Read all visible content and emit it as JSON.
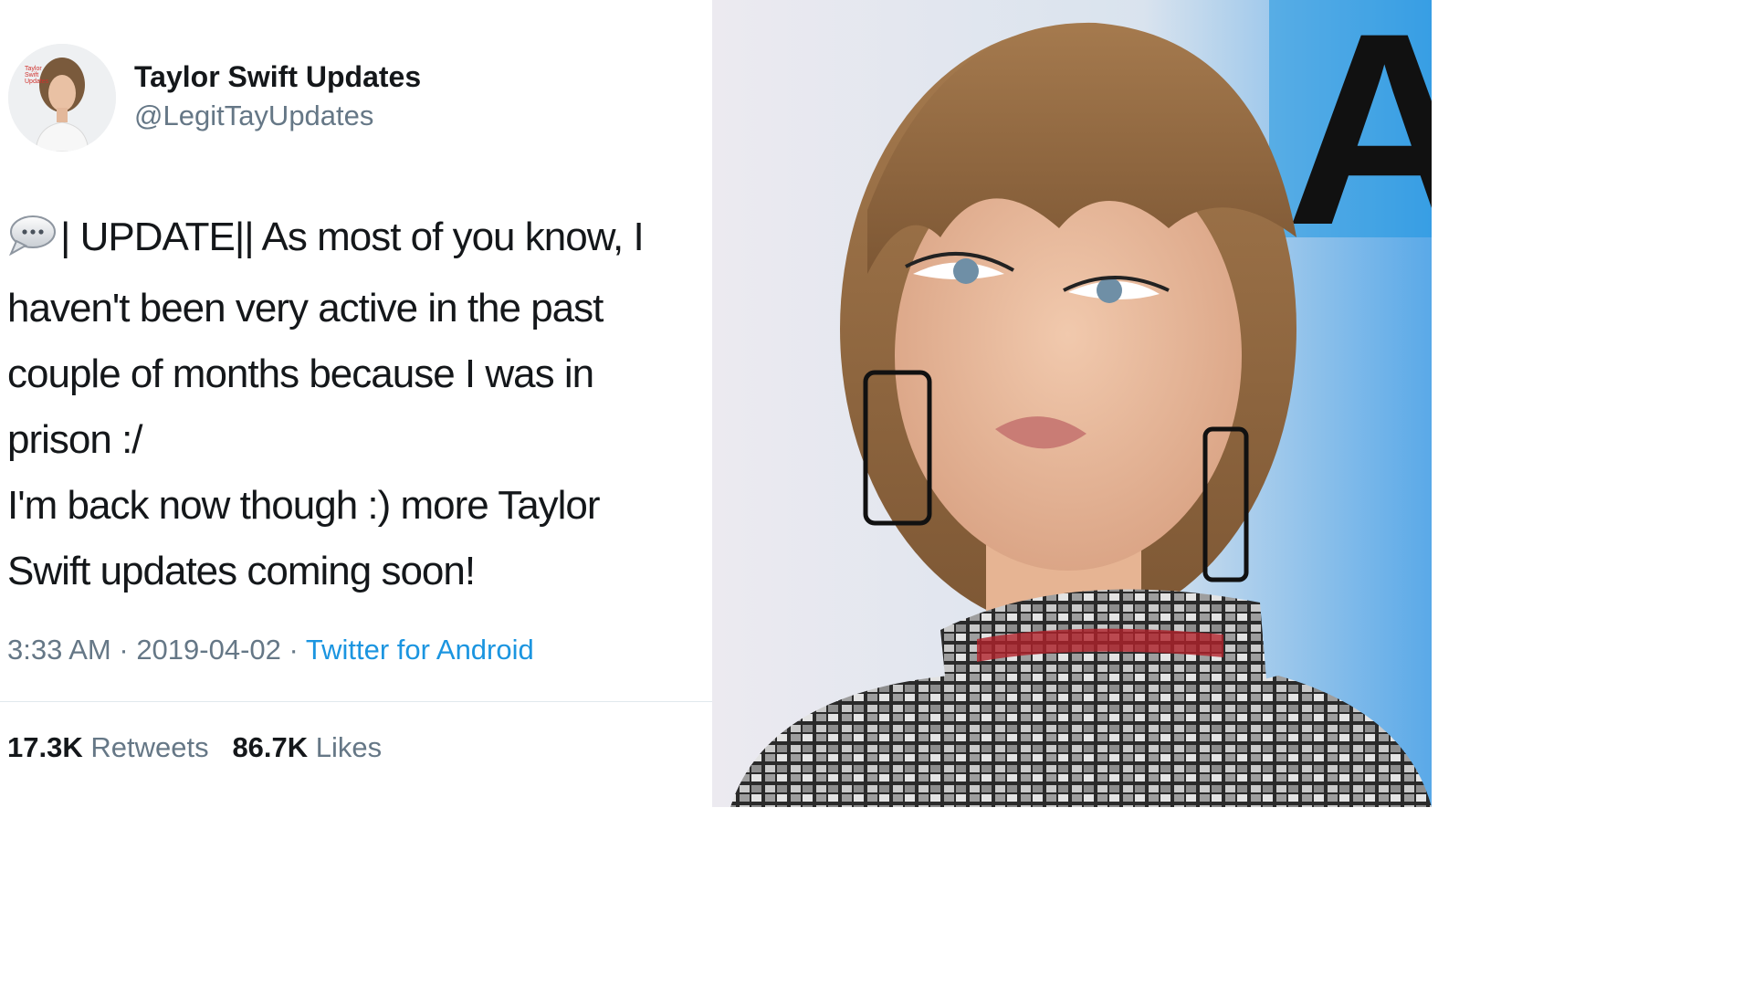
{
  "account": {
    "display_name": "Taylor Swift Updates",
    "handle": "@LegitTayUpdates",
    "avatar_caption": "Taylor Swift Updates"
  },
  "tweet": {
    "icon": "speech-bubble-icon",
    "lines": [
      "| UPDATE|| As most of you know, I",
      "haven't been very active in the past",
      "couple of months because I was in",
      "prison :/",
      "I'm back now though :) more Taylor",
      "Swift updates coming soon!"
    ],
    "time": "3:33 AM",
    "date": "2019-04-02",
    "source": "Twitter for Android"
  },
  "stats": {
    "retweets_count": "17.3K",
    "retweets_label": "Retweets",
    "likes_count": "86.7K",
    "likes_label": "Likes"
  },
  "photo": {
    "letter": "A"
  },
  "colors": {
    "text": "#14171a",
    "secondary": "#657786",
    "link": "#1b95e0",
    "divider": "#e1e8ed"
  }
}
